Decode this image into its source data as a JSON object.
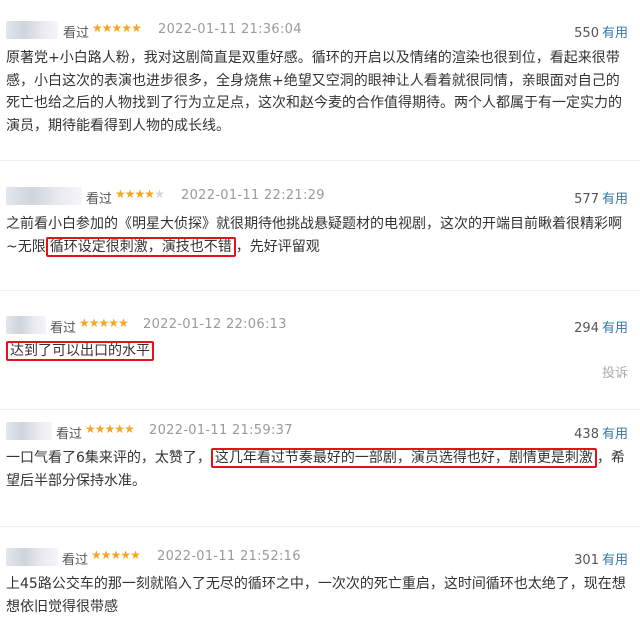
{
  "reviews": [
    {
      "status": "看过",
      "rating": 5,
      "date": "2022-01-11 21:36:04",
      "useful_count": "550",
      "useful_label": "有用",
      "text": "原著党+小白路人粉，我对这剧简直是双重好感。循环的开启以及情绪的渲染也很到位，看起来很带感，小白这次的表演也进步很多，全身烧焦+绝望又空洞的眼神让人看着就很同情，亲眼面对自己的死亡也给之后的人物找到了行为立足点，这次和赵今麦的合作值得期待。两个人都属于有一定实力的演员，期待能看得到人物的成长线。"
    },
    {
      "status": "看过",
      "rating": 4,
      "date": "2022-01-11 22:21:29",
      "useful_count": "577",
      "useful_label": "有用",
      "text_before": "之前看小白参加的《明星大侦探》就很期待他挑战悬疑题材的电视剧，这次的开端目前瞅着很精彩啊~无限",
      "text_highlight": "循环设定很刺激，演技也不错",
      "text_after": "，先好评留观"
    },
    {
      "status": "看过",
      "rating": 5,
      "date": "2022-01-12 22:06:13",
      "useful_count": "294",
      "useful_label": "有用",
      "text_highlight": "达到了可以出口的水平",
      "report_label": "投诉"
    },
    {
      "status": "看过",
      "rating": 5,
      "date": "2022-01-11 21:59:37",
      "useful_count": "438",
      "useful_label": "有用",
      "text_before": "一口气看了6集来评的，太赞了，",
      "text_highlight": "这几年看过节奏最好的一部剧，演员选得也好，剧情更是刺激",
      "text_after": "，希望后半部分保持水准。"
    },
    {
      "status": "看过",
      "rating": 5,
      "date": "2022-01-11 21:52:16",
      "useful_count": "301",
      "useful_label": "有用",
      "text": "上45路公交车的那一刻就陷入了无尽的循环之中，一次次的死亡重启，这时间循环也太绝了，现在想想依旧觉得很带感"
    }
  ],
  "colors": {
    "star_on": "#f5a623",
    "highlight_border": "#e3121b",
    "useful_link": "#3377aa"
  },
  "icons": {
    "star": "star-icon",
    "user_name": "blurred-username"
  }
}
